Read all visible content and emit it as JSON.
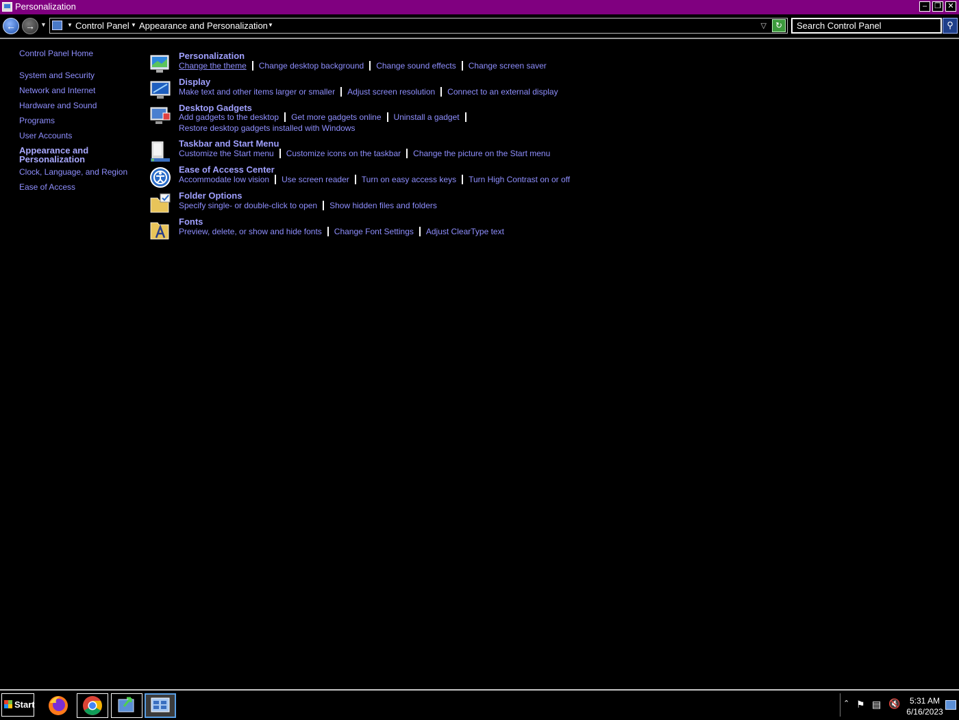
{
  "window": {
    "title": "Personalization"
  },
  "address": {
    "crumbs": [
      "Control Panel",
      "Appearance and Personalization"
    ],
    "search_placeholder": "Search Control Panel"
  },
  "sidebar": {
    "items": [
      "Control Panel Home",
      "System and Security",
      "Network and Internet",
      "Hardware and Sound",
      "Programs",
      "User Accounts",
      "Appearance and Personalization",
      "Clock, Language, and Region",
      "Ease of Access"
    ]
  },
  "categories": [
    {
      "title": "Personalization",
      "icon": "personalization-icon",
      "lines": [
        [
          "Change the theme",
          "Change desktop background",
          "Change sound effects",
          "Change screen saver"
        ]
      ]
    },
    {
      "title": "Display",
      "icon": "display-icon",
      "lines": [
        [
          "Make text and other items larger or smaller",
          "Adjust screen resolution",
          "Connect to an external display"
        ]
      ]
    },
    {
      "title": "Desktop Gadgets",
      "icon": "gadgets-icon",
      "lines": [
        [
          "Add gadgets to the desktop",
          "Get more gadgets online",
          "Uninstall a gadget"
        ],
        [
          "Restore desktop gadgets installed with Windows"
        ]
      ]
    },
    {
      "title": "Taskbar and Start Menu",
      "icon": "taskbar-icon",
      "lines": [
        [
          "Customize the Start menu",
          "Customize icons on the taskbar",
          "Change the picture on the Start menu"
        ]
      ]
    },
    {
      "title": "Ease of Access Center",
      "icon": "ease-of-access-icon",
      "lines": [
        [
          "Accommodate low vision",
          "Use screen reader",
          "Turn on easy access keys",
          "Turn High Contrast on or off"
        ]
      ]
    },
    {
      "title": "Folder Options",
      "icon": "folder-options-icon",
      "lines": [
        [
          "Specify single- or double-click to open",
          "Show hidden files and folders"
        ]
      ]
    },
    {
      "title": "Fonts",
      "icon": "fonts-icon",
      "lines": [
        [
          "Preview, delete, or show and hide fonts",
          "Change Font Settings",
          "Adjust ClearType text"
        ]
      ]
    }
  ],
  "taskbar": {
    "start_label": "Start",
    "time": "5:31 AM",
    "date": "6/16/2023"
  }
}
